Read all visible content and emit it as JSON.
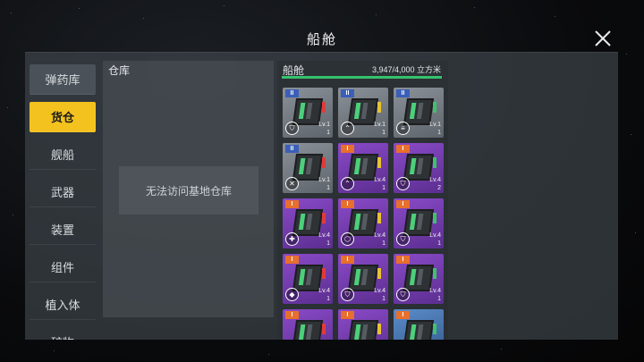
{
  "window": {
    "title": "船舱"
  },
  "sidebar": {
    "items": [
      {
        "label": "弹药库",
        "state": "normal"
      },
      {
        "label": "货仓",
        "state": "active"
      },
      {
        "label": "舰船",
        "state": "normal"
      },
      {
        "label": "武器",
        "state": "normal"
      },
      {
        "label": "装置",
        "state": "normal"
      },
      {
        "label": "组件",
        "state": "normal"
      },
      {
        "label": "植入体",
        "state": "normal"
      },
      {
        "label": "矿物",
        "state": "normal"
      }
    ]
  },
  "warehouse": {
    "title": "仓库",
    "message": "无法访问基地仓库"
  },
  "hold": {
    "title": "船舱",
    "capacity_text": "3,947/4,000 立方米",
    "capacity_fraction": 0.987,
    "items": [
      {
        "tier": "II",
        "rarity": "grey",
        "level": "Lv.1",
        "count": "1",
        "icon": "shield-icon"
      },
      {
        "tier": "II",
        "rarity": "grey",
        "level": "Lv.1",
        "count": "1",
        "icon": "chevron-up-icon"
      },
      {
        "tier": "II",
        "rarity": "grey",
        "level": "Lv.1",
        "count": "1",
        "icon": "bars-icon"
      },
      {
        "tier": "II",
        "rarity": "grey",
        "level": "Lv.1",
        "count": "1",
        "icon": "crossed-icon"
      },
      {
        "tier": "I",
        "rarity": "purple",
        "level": "Lv.4",
        "count": "1",
        "icon": "chevron-up-icon"
      },
      {
        "tier": "I",
        "rarity": "purple",
        "level": "Lv.4",
        "count": "2",
        "icon": "shield-icon"
      },
      {
        "tier": "I",
        "rarity": "purple",
        "level": "Lv.4",
        "count": "1",
        "icon": "cross-icon"
      },
      {
        "tier": "I",
        "rarity": "purple",
        "level": "Lv.4",
        "count": "1",
        "icon": "hexagon-icon"
      },
      {
        "tier": "I",
        "rarity": "purple",
        "level": "Lv.4",
        "count": "1",
        "icon": "shield-icon"
      },
      {
        "tier": "I",
        "rarity": "purple",
        "level": "Lv.4",
        "count": "1",
        "icon": "drop-icon"
      },
      {
        "tier": "I",
        "rarity": "purple",
        "level": "Lv.4",
        "count": "1",
        "icon": "shield-icon"
      },
      {
        "tier": "I",
        "rarity": "purple",
        "level": "Lv.4",
        "count": "1",
        "icon": "shield-icon"
      },
      {
        "tier": "I",
        "rarity": "purple",
        "level": "",
        "count": "",
        "icon": ""
      },
      {
        "tier": "I",
        "rarity": "purple",
        "level": "",
        "count": "",
        "icon": ""
      },
      {
        "tier": "I",
        "rarity": "blue",
        "level": "",
        "count": "",
        "icon": ""
      }
    ]
  },
  "colors": {
    "accent": "#f4c21f",
    "capacity_bar": "#35c26b",
    "rarity_grey": "#8b9198",
    "rarity_purple": "#8a4ac8",
    "rarity_blue": "#5b8cc9"
  }
}
